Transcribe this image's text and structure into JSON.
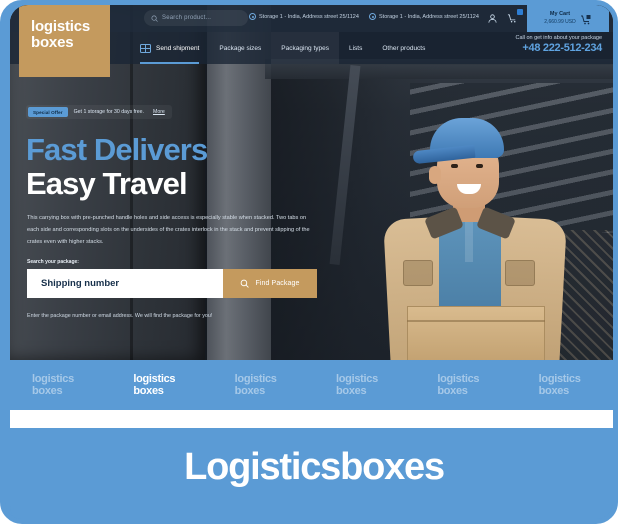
{
  "brand": {
    "logo_line1": "logistics",
    "logo_line2": "boxes"
  },
  "topbar": {
    "search_placeholder": "Search product...",
    "storage_a": "Storage 1 - India, Address street 25/1124",
    "storage_b": "Storage 1 - India, Address street 25/1124",
    "account_icon": "user-icon",
    "cart_icon": "cart-icon",
    "cart_label": "My Cart",
    "cart_amount": "2,660.99 USD"
  },
  "nav": {
    "items": [
      {
        "label": "Send shipment",
        "icon": "grid-icon",
        "active": true
      },
      {
        "label": "Package sizes",
        "active": false
      },
      {
        "label": "Packaging types",
        "active": false
      },
      {
        "label": "Lists",
        "active": false
      },
      {
        "label": "Other products",
        "active": false
      }
    ],
    "call_caption": "Call on get info about your package",
    "call_phone": "+48 222-512-234"
  },
  "hero": {
    "offer_tag": "Special Offer",
    "offer_text": "Get 1 storage for 30 days free.",
    "offer_more": "More",
    "title_line1": "Fast Delivers",
    "title_line2": "Easy Travel",
    "paragraph": "This carrying box with pre-punched handle holes and side access is especially stable when stacked. Two tabs on each side and corresponding slots on the undersides of the crates interlock in the stack and prevent slipping of the crates even with higher stacks.",
    "search_label": "Search your package:",
    "search_value": "Shipping number",
    "search_placeholder": "Shipping number",
    "find_button": "Find Package",
    "find_icon": "search-icon",
    "hint": "Enter the package number or email address. We will find the package for you!"
  },
  "partners": [
    {
      "line1": "logistics",
      "line2": "boxes",
      "active": false
    },
    {
      "line1": "logistics",
      "line2": "boxes",
      "active": true
    },
    {
      "line1": "logistics",
      "line2": "boxes",
      "active": false
    },
    {
      "line1": "logistics",
      "line2": "boxes",
      "active": false
    },
    {
      "line1": "logistics",
      "line2": "boxes",
      "active": false
    },
    {
      "line1": "logistics",
      "line2": "boxes",
      "active": false
    }
  ],
  "footer": {
    "title": "Logisticsboxes"
  },
  "colors": {
    "accent_blue": "#5b9bd5",
    "logo_tan": "#c49a5e",
    "dark_navy": "#1e2a3a",
    "white": "#ffffff"
  }
}
